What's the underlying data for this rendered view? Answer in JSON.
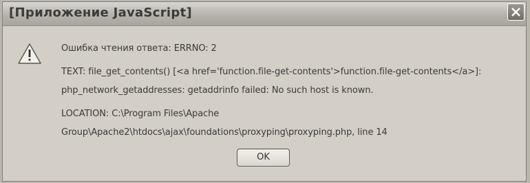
{
  "dialog": {
    "title": "[Приложение JavaScript]",
    "close_icon": "close-icon",
    "icon": "warning-icon",
    "lines": [
      "Ошибка чтения ответа: ERRNO: 2",
      "TEXT: file_get_contents() [<a href='function.file-get-contents'>function.file-get-contents</a>]:",
      "php_network_getaddresses: getaddrinfo failed: No such host is known.",
      "LOCATION: C:\\Program Files\\Apache",
      "Group\\Apache2\\htdocs\\ajax\\foundations\\proxyping\\proxyping.php, line 14"
    ],
    "ok_label": "OK"
  }
}
